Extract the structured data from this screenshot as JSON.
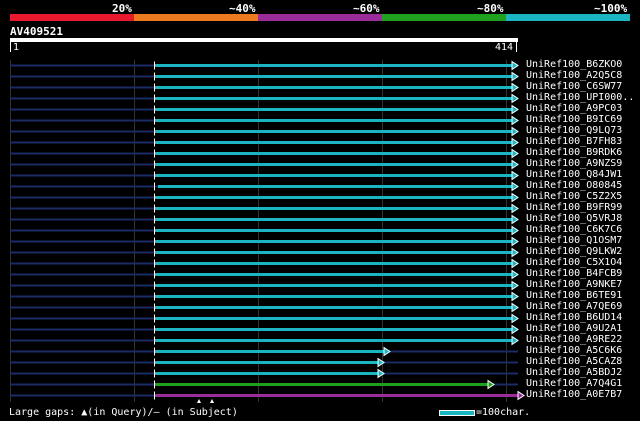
{
  "query": {
    "id": "AV409521",
    "start": "1",
    "end": "414"
  },
  "color_key": [
    {
      "label": "20%",
      "color": "#e8192c"
    },
    {
      "label": "~40%",
      "color": "#ee7a1f"
    },
    {
      "label": "~60%",
      "color": "#9b2d9b"
    },
    {
      "label": "~80%",
      "color": "#1fa01f"
    },
    {
      "label": "~100%",
      "color": "#19b6c2"
    }
  ],
  "hits": [
    {
      "name": "UniRef100_B6ZKO0",
      "color": "#19b6c2"
    },
    {
      "name": "UniRef100_A2Q5C8",
      "color": "#19b6c2"
    },
    {
      "name": "UniRef100_C6SW77",
      "color": "#19b6c2"
    },
    {
      "name": "UniRef100_UPI000..",
      "color": "#19b6c2"
    },
    {
      "name": "UniRef100_A9PC03",
      "color": "#19b6c2"
    },
    {
      "name": "UniRef100_B9IC69",
      "color": "#19b6c2"
    },
    {
      "name": "UniRef100_Q9LQ73",
      "color": "#19b6c2"
    },
    {
      "name": "UniRef100_B7FH83",
      "color": "#19b6c2"
    },
    {
      "name": "UniRef100_B9RDK6",
      "color": "#19b6c2"
    },
    {
      "name": "UniRef100_A9NZS9",
      "color": "#19b6c2"
    },
    {
      "name": "UniRef100_Q84JW1",
      "color": "#19b6c2"
    },
    {
      "name": "UniRef100_O80845",
      "color": "#19b6c2"
    },
    {
      "name": "UniRef100_C5Z2X5",
      "color": "#19b6c2"
    },
    {
      "name": "UniRef100_B9FR99",
      "color": "#19b6c2"
    },
    {
      "name": "UniRef100_Q5VRJ8",
      "color": "#19b6c2"
    },
    {
      "name": "UniRef100_C6K7C6",
      "color": "#19b6c2"
    },
    {
      "name": "UniRef100_Q1OSM7",
      "color": "#19b6c2"
    },
    {
      "name": "UniRef100_Q9LKW2",
      "color": "#19b6c2"
    },
    {
      "name": "UniRef100_C5X1O4",
      "color": "#19b6c2"
    },
    {
      "name": "UniRef100_B4FCB9",
      "color": "#19b6c2"
    },
    {
      "name": "UniRef100_A9NKE7",
      "color": "#19b6c2"
    },
    {
      "name": "UniRef100_B6TE91",
      "color": "#19b6c2"
    },
    {
      "name": "UniRef100_A7QE69",
      "color": "#19b6c2"
    },
    {
      "name": "UniRef100_B6UD14",
      "color": "#19b6c2"
    },
    {
      "name": "UniRef100_A9U2A1",
      "color": "#19b6c2"
    },
    {
      "name": "UniRef100_A9RE22",
      "color": "#19b6c2"
    },
    {
      "name": "UniRef100_A5C6K6",
      "color": "#19b6c2"
    },
    {
      "name": "UniRef100_A5CAZ8",
      "color": "#19b6c2"
    },
    {
      "name": "UniRef100_A5BDJ2",
      "color": "#19b6c2"
    },
    {
      "name": "UniRef100_A7Q4G1",
      "color": "#1fa01f"
    },
    {
      "name": "UniRef100_A0E7B7",
      "color": "#9b2d9b"
    }
  ],
  "footer": {
    "gaps_prefix": "Large gaps:",
    "gaps_query": "(in Query)/",
    "gaps_subject": "(in Subject)",
    "scale_label": "=100char."
  }
}
